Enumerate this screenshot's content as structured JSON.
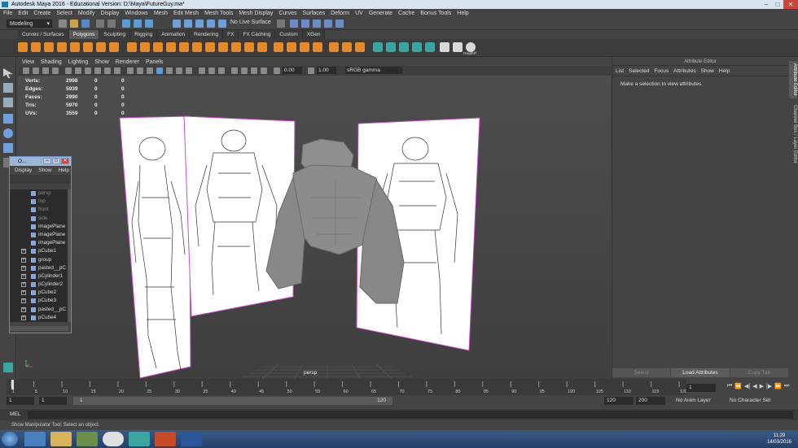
{
  "window": {
    "title": "Autodesk Maya 2016 - Educational Version: D:\\Maya\\FutureGuy.ma*"
  },
  "menubar": [
    "File",
    "Edit",
    "Create",
    "Select",
    "Modify",
    "Display",
    "Windows",
    "Mesh",
    "Edit Mesh",
    "Mesh Tools",
    "Mesh Display",
    "Curves",
    "Surfaces",
    "Deform",
    "UV",
    "Generate",
    "Cache",
    "Bonus Tools",
    "Help"
  ],
  "statusline": {
    "mode": "Modeling",
    "live_surface": "No Live Surface"
  },
  "shelf_tabs": [
    {
      "label": "Curves / Surfaces",
      "active": false
    },
    {
      "label": "Polygons",
      "active": true
    },
    {
      "label": "Sculpting",
      "active": false
    },
    {
      "label": "Rigging",
      "active": false
    },
    {
      "label": "Animation",
      "active": false
    },
    {
      "label": "Rendering",
      "active": false
    },
    {
      "label": "FX",
      "active": false
    },
    {
      "label": "FX Caching",
      "active": false
    },
    {
      "label": "Custom",
      "active": false
    },
    {
      "label": "XGen",
      "active": false
    }
  ],
  "shelf": {
    "last_icon_label": "GraphFl"
  },
  "panel_menu": [
    "View",
    "Shading",
    "Lighting",
    "Show",
    "Renderer",
    "Panels"
  ],
  "panel_tools": {
    "exposure": "0.00",
    "gamma": "1.00",
    "color_space": "sRGB gamma"
  },
  "hud": {
    "rows": [
      {
        "label": "Verts:",
        "value": "2998",
        "sel": "0",
        "uv": "0"
      },
      {
        "label": "Edges:",
        "value": "5939",
        "sel": "0",
        "uv": "0"
      },
      {
        "label": "Faces:",
        "value": "2990",
        "sel": "0",
        "uv": "0"
      },
      {
        "label": "Tris:",
        "value": "5970",
        "sel": "0",
        "uv": "0"
      },
      {
        "label": "UVs:",
        "value": "3559",
        "sel": "0",
        "uv": "0"
      }
    ]
  },
  "viewport": {
    "camera_label": "persp"
  },
  "outliner": {
    "title": "O...",
    "menu": [
      "Display",
      "Show",
      "Help"
    ],
    "items": [
      {
        "label": "persp",
        "dim": true,
        "expand": false
      },
      {
        "label": "top",
        "dim": true,
        "expand": false
      },
      {
        "label": "front",
        "dim": true,
        "expand": false
      },
      {
        "label": "side",
        "dim": true,
        "expand": false
      },
      {
        "label": "imagePlane",
        "dim": false,
        "expand": false
      },
      {
        "label": "imagePlane",
        "dim": false,
        "expand": false
      },
      {
        "label": "imagePlane",
        "dim": false,
        "expand": false
      },
      {
        "label": "pCube1",
        "dim": false,
        "expand": true
      },
      {
        "label": "group",
        "dim": false,
        "expand": true
      },
      {
        "label": "pasted__pC",
        "dim": false,
        "expand": true
      },
      {
        "label": "pCylinder1",
        "dim": false,
        "expand": true
      },
      {
        "label": "pCylinder2",
        "dim": false,
        "expand": true
      },
      {
        "label": "pCube2",
        "dim": false,
        "expand": true
      },
      {
        "label": "pCube3",
        "dim": false,
        "expand": true
      },
      {
        "label": "pasted__pC",
        "dim": false,
        "expand": true
      },
      {
        "label": "pCube4",
        "dim": false,
        "expand": true
      },
      {
        "label": "pCube5",
        "dim": false,
        "expand": true
      }
    ]
  },
  "attribute_editor": {
    "header": "Attribute Editor",
    "menu": [
      "List",
      "Selected",
      "Focus",
      "Attributes",
      "Show",
      "Help"
    ],
    "message": "Make a selection to view attributes",
    "buttons": {
      "select": "Select",
      "load": "Load Attributes",
      "copy": "Copy Tab"
    }
  },
  "side_tabs": {
    "attribute_editor": "Attribute Editor",
    "channel_box": "Channel Box / Layer Editor"
  },
  "time_slider": {
    "ticks": [
      "1",
      "5",
      "10",
      "15",
      "20",
      "25",
      "30",
      "35",
      "40",
      "45",
      "50",
      "55",
      "60",
      "65",
      "70",
      "75",
      "80",
      "85",
      "90",
      "95",
      "100",
      "105",
      "110",
      "115",
      "120"
    ],
    "current_frame": "1"
  },
  "range_slider": {
    "start": "1",
    "playback_start": "1",
    "range_start": "1",
    "range_end": "120",
    "playback_end": "120",
    "end": "200",
    "anim_layer": "No Anim Layer",
    "character_set": "No Character Set"
  },
  "command_line": {
    "label": "MEL"
  },
  "help_line": "Show Manipulator Tool: Select an object.",
  "taskbar": {
    "time": "11:29",
    "date": "14/03/2016"
  }
}
